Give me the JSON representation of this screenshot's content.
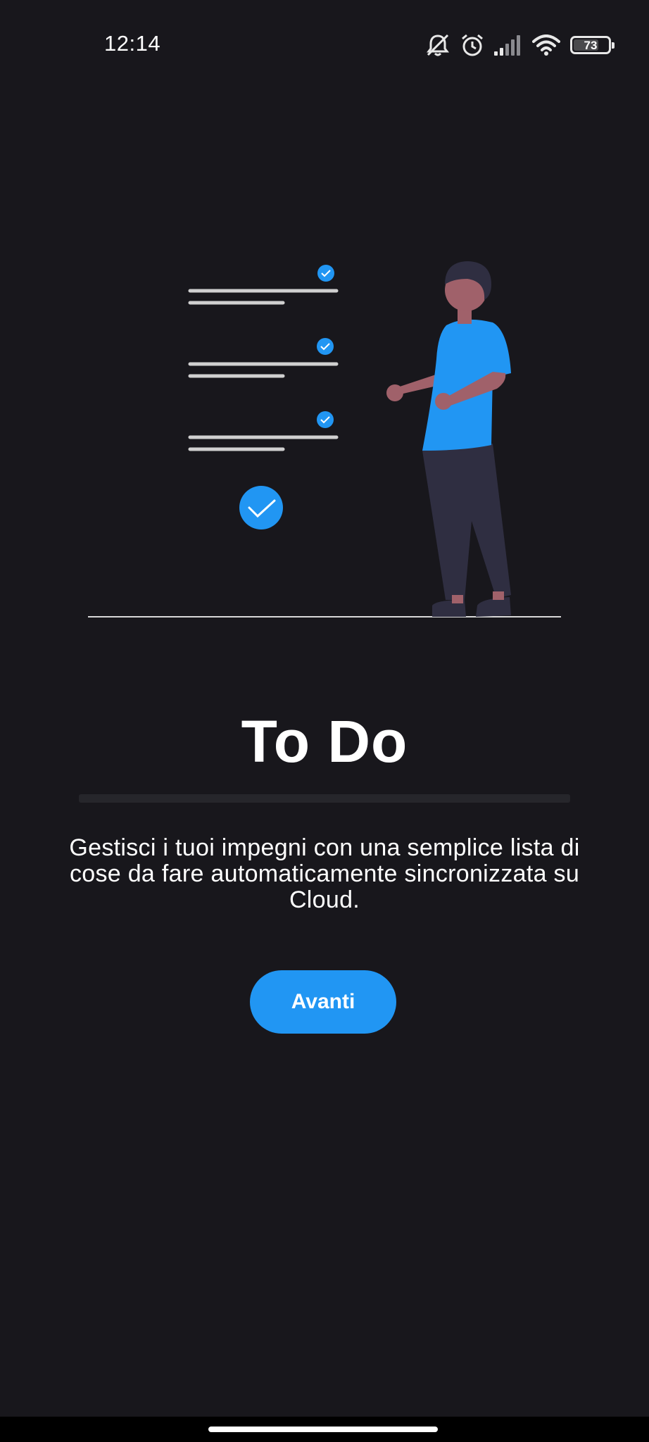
{
  "status_bar": {
    "time": "12:14",
    "battery_level": "73",
    "battery_fraction": 0.73,
    "icons": [
      "mute-icon",
      "alarm-icon",
      "signal-icon",
      "wifi-icon",
      "battery-icon"
    ]
  },
  "onboarding": {
    "title": "To Do",
    "description": "Gestisci i tuoi impegni con una semplice lista di cose da fare automaticamente sincronizzata su Cloud.",
    "next_label": "Avanti"
  },
  "colors": {
    "background": "#18171c",
    "accent": "#2196f3",
    "text": "#ffffff"
  }
}
